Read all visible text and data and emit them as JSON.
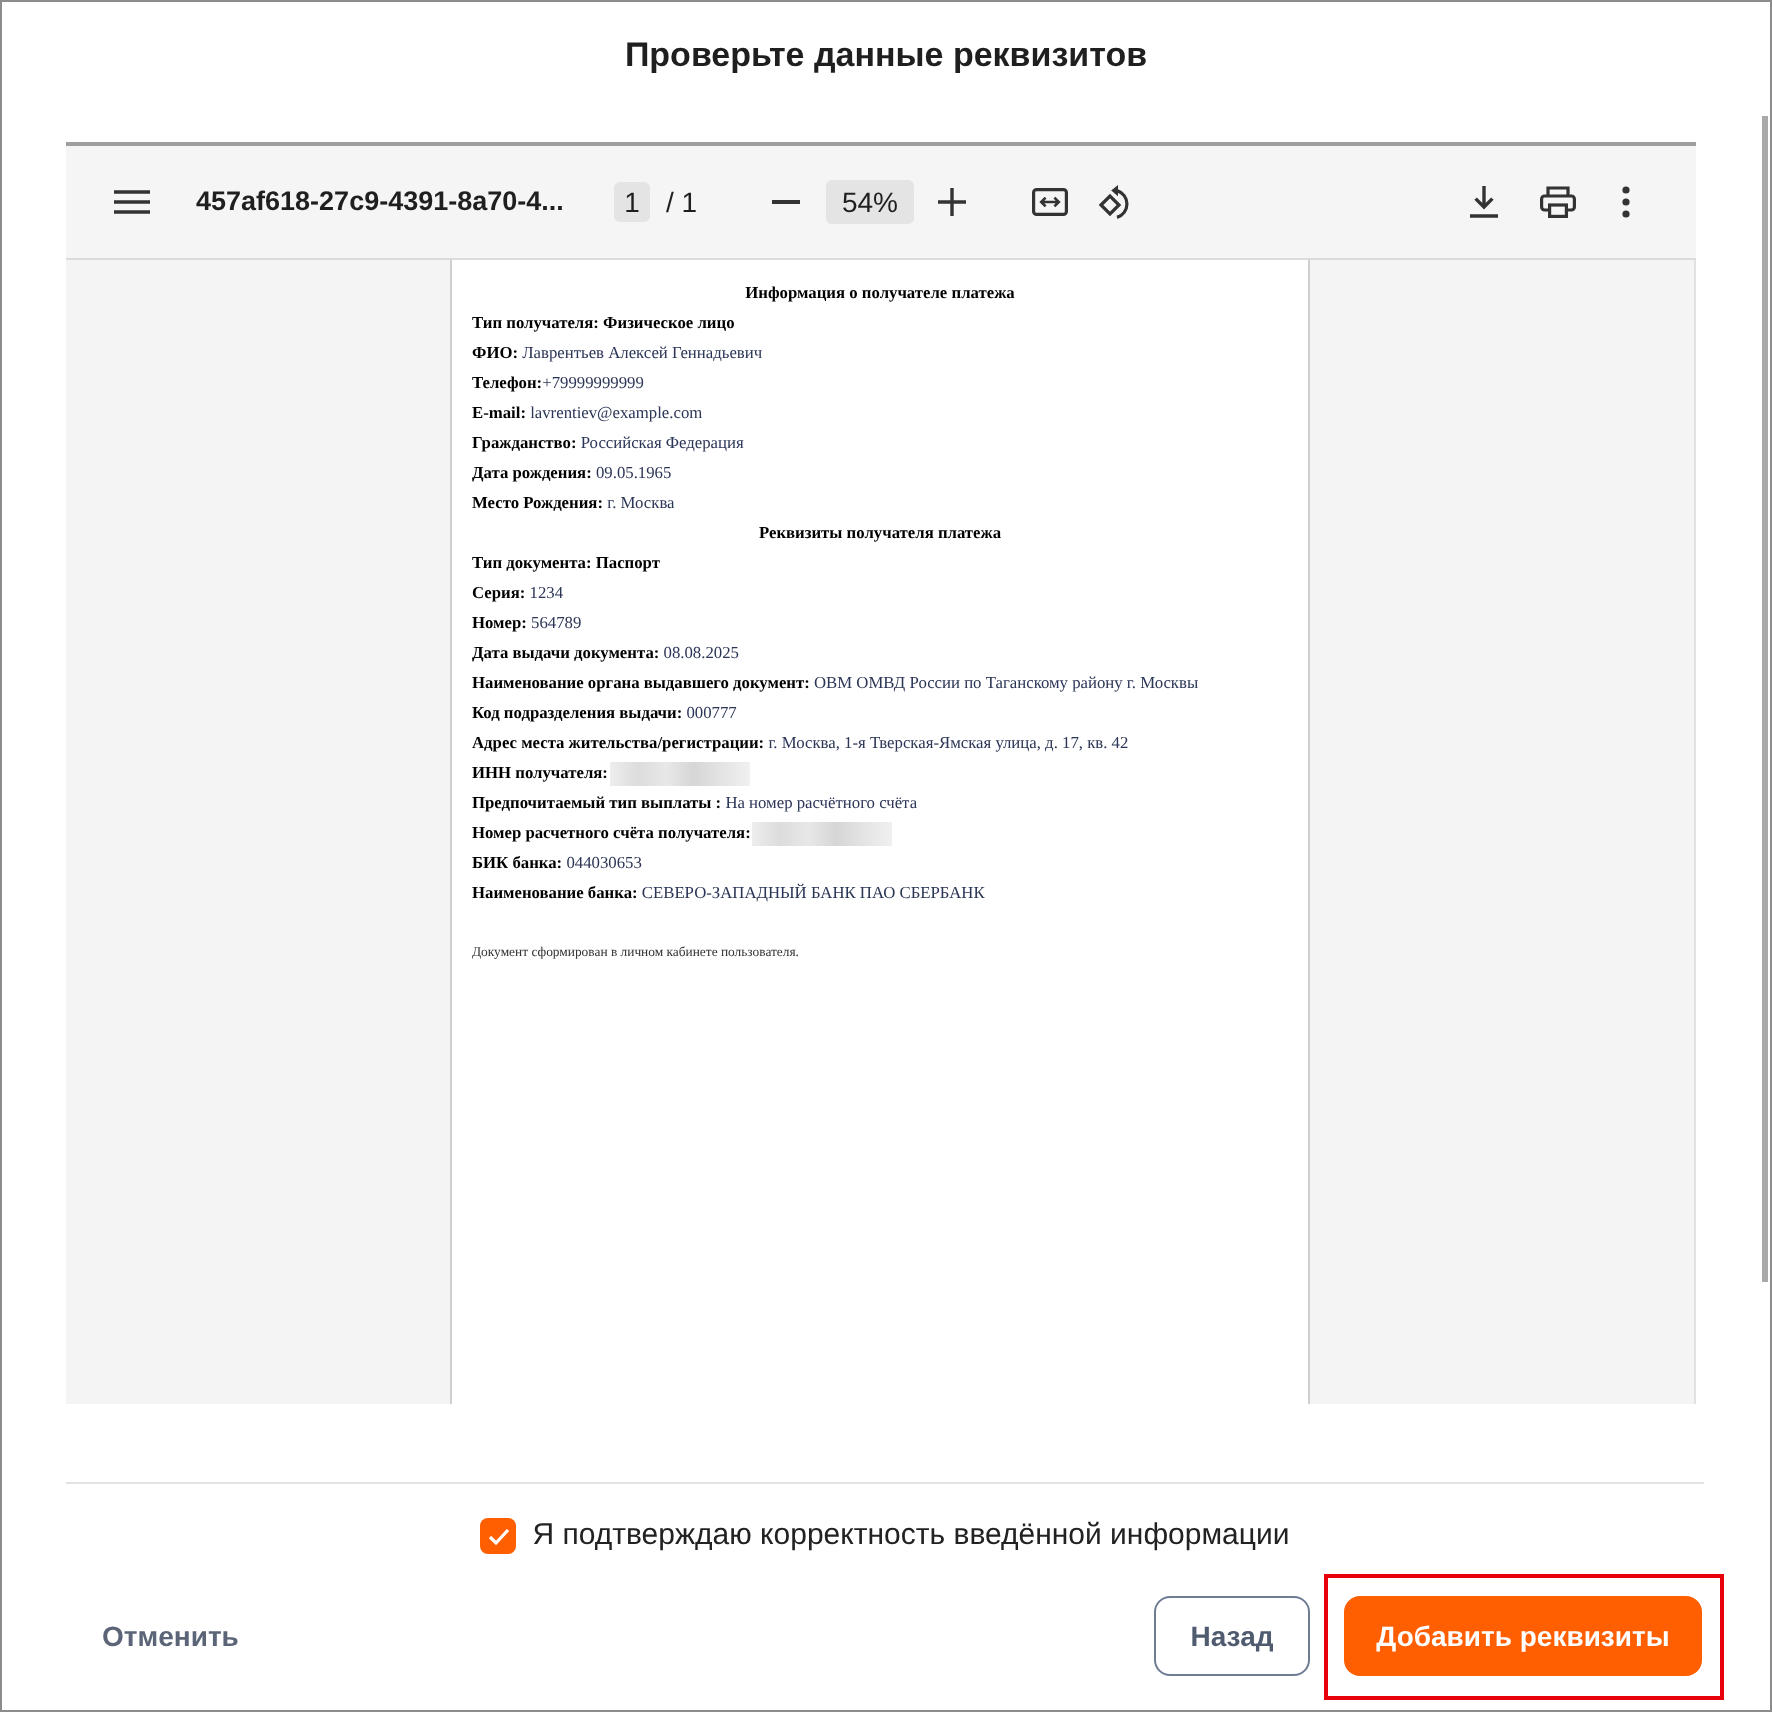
{
  "dialog": {
    "title": "Проверьте данные реквизитов"
  },
  "pdf_viewer": {
    "toolbar": {
      "file_name": "457af618-27c9-4391-8a70-4...",
      "page_input": "1",
      "page_total": "/ 1",
      "zoom": "54%"
    },
    "document": {
      "sections": [
        {
          "heading": "Информация о получателе платежа",
          "rows": [
            {
              "kind": "bold",
              "text": "Тип получателя: Физическое лицо"
            },
            {
              "kind": "plain",
              "text": "**ФИО:** Лаврентьев Алексей Геннадьевич"
            },
            {
              "kind": "plain",
              "text": "**Телефон:**+79999999999"
            },
            {
              "kind": "plain",
              "text": "**E-mail:** lavrentiev@example.com"
            },
            {
              "kind": "plain",
              "text": "**Гражданство:** Российская Федерация"
            },
            {
              "kind": "plain",
              "text": "**Дата рождения:** 09.05.1965"
            },
            {
              "kind": "plain",
              "text": "**Место Рождения:** г. Москва"
            }
          ]
        },
        {
          "heading": "Реквизиты получателя платежа",
          "rows": [
            {
              "kind": "bold",
              "text": "Тип документа: Паспорт"
            },
            {
              "kind": "plain",
              "text": "**Серия:** 1234"
            },
            {
              "kind": "plain",
              "text": "**Номер:** 564789"
            },
            {
              "kind": "plain",
              "text": "**Дата выдачи документа:** 08.08.2025"
            },
            {
              "kind": "plain",
              "text": "**Наименование органа выдавшего документ:** ОВМ ОМВД России по Таганскому району г. Москвы"
            },
            {
              "kind": "plain",
              "text": "**Код подразделения выдачи:** 000777"
            },
            {
              "kind": "plain",
              "text": "**Адрес места жительства/регистрации:** г. Москва, 1-я Тверская-Ямская улица, д. 17, кв. 42"
            },
            {
              "kind": "redacted",
              "label": "ИНН получателя:"
            },
            {
              "kind": "plain",
              "text": "**Предпочитаемый тип выплаты :** На номер расчётного счёта"
            },
            {
              "kind": "redacted",
              "label": "Номер расчетного счёта получателя:"
            },
            {
              "kind": "plain",
              "text": "**БИК банка:** 044030653"
            },
            {
              "kind": "plain",
              "text": "**Наименование банка:** СЕВЕРО-ЗАПАДНЫЙ БАНК ПАО СБЕРБАНК"
            }
          ]
        }
      ],
      "footnote": "Документ сформирован в личном кабинете пользователя."
    }
  },
  "confirmation": {
    "label": "Я подтверждаю корректность введённой информации",
    "checked": true
  },
  "buttons": [
    {
      "kind": "link",
      "label": "Отменить",
      "highlighted": false
    },
    {
      "kind": "outline",
      "label": "Назад",
      "highlighted": false
    },
    {
      "kind": "primary",
      "label": "Добавить реквизиты",
      "highlighted": true
    }
  ]
}
